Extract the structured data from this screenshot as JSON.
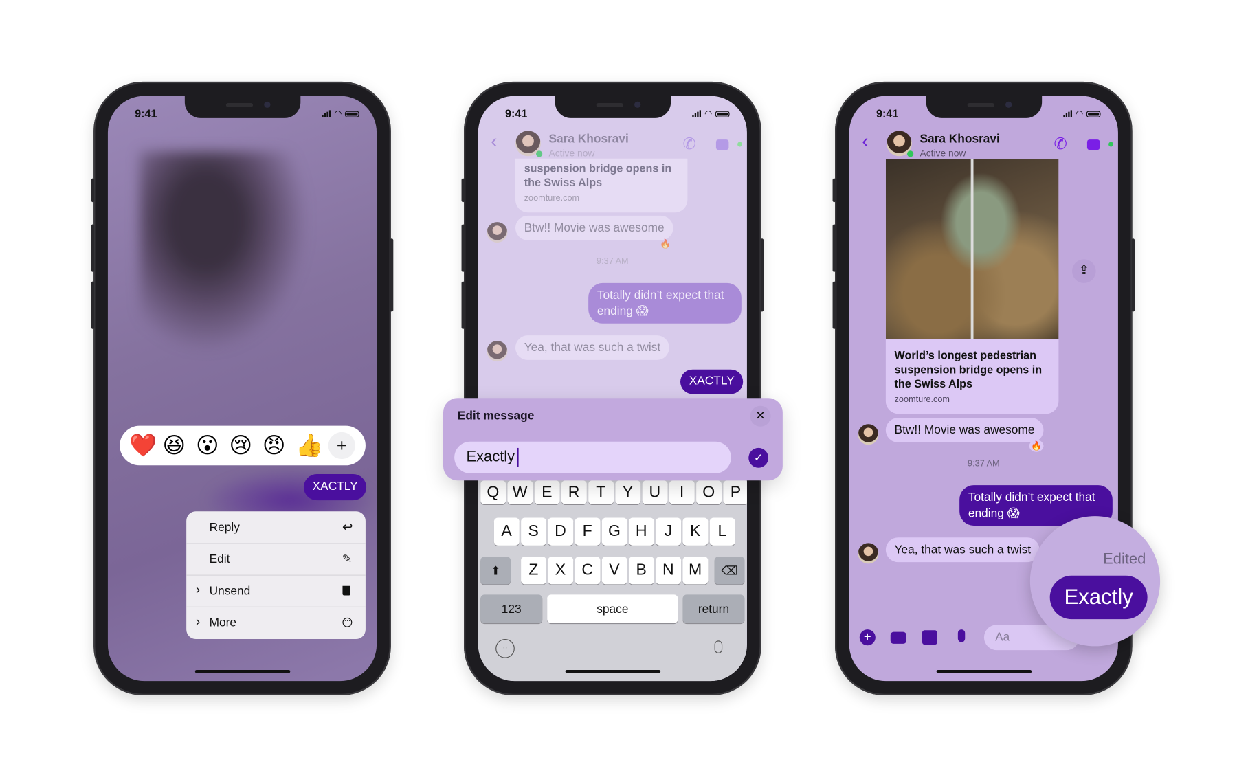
{
  "status_time": "9:41",
  "colors": {
    "accent": "#4a0f9e",
    "chat_bg": "#c0a8dc",
    "panel_bg": "#c2a9de",
    "input_bg": "#e4d4fa",
    "incoming_bubble": "#dcc8f5",
    "online": "#31c65b"
  },
  "contact": {
    "name": "Sara Khosravi",
    "status": "Active now"
  },
  "link_card": {
    "title": "World’s longest pedestrian suspension bridge opens in the Swiss Alps",
    "title_partial": "suspension bridge opens in the Swiss Alps",
    "domain": "zoomture.com"
  },
  "messages": {
    "incoming_1": "Btw!! Movie was awesome",
    "reaction_1": "🔥",
    "timestamp": "9:37 AM",
    "outgoing_1": "Totally didn’t expect that ending 😱",
    "incoming_2": "Yea, that was such a twist",
    "outgoing_2": "XACTLY"
  },
  "phone1": {
    "reactions": [
      "❤️",
      "😆",
      "😮",
      "😢",
      "😠",
      "👍"
    ],
    "add_reaction": "+",
    "menu": [
      {
        "label": "Reply",
        "icon": "reply-icon",
        "chevron": false
      },
      {
        "label": "Edit",
        "icon": "pencil-icon",
        "chevron": false
      },
      {
        "label": "Unsend",
        "icon": "trash-icon",
        "chevron": true
      },
      {
        "label": "More",
        "icon": "more-circle-icon",
        "chevron": true
      }
    ],
    "chevron": "›"
  },
  "phone2": {
    "edit_title": "Edit message",
    "close": "✕",
    "input_value": "Exactly",
    "keyboard": {
      "row1": [
        "Q",
        "W",
        "E",
        "R",
        "T",
        "Y",
        "U",
        "I",
        "O",
        "P"
      ],
      "row2": [
        "A",
        "S",
        "D",
        "F",
        "G",
        "H",
        "J",
        "K",
        "L"
      ],
      "row3": [
        "Z",
        "X",
        "C",
        "V",
        "B",
        "N",
        "M"
      ],
      "num": "123",
      "space": "space",
      "return": "return"
    }
  },
  "phone3": {
    "edited_label": "Edited",
    "edited_message": "Exactly",
    "composer_placeholder": "Aa"
  }
}
